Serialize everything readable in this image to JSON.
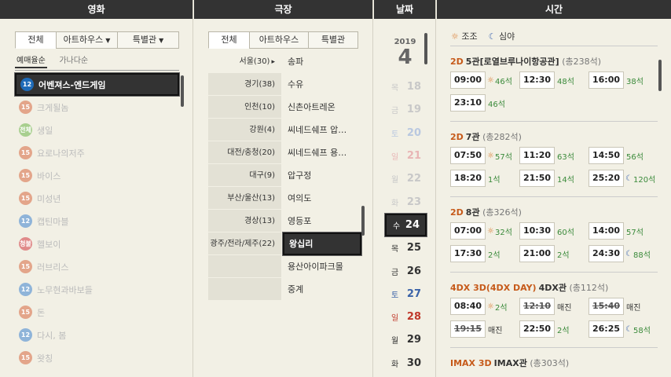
{
  "headers": {
    "movie": "영화",
    "theater": "극장",
    "date": "날짜",
    "time": "시간"
  },
  "movie": {
    "tabs": [
      "전체",
      "아트하우스",
      "특별관"
    ],
    "sort": [
      "예매율순",
      "가나다순"
    ],
    "items": [
      {
        "title": "어벤져스-엔드게임",
        "rating": "12",
        "color": "#1e6bb8",
        "selected": true
      },
      {
        "title": "크게될놈",
        "rating": "15",
        "color": "#e3a58a"
      },
      {
        "title": "생일",
        "rating": "전체",
        "color": "#a8cf8f"
      },
      {
        "title": "요로나의저주",
        "rating": "15",
        "color": "#e3a58a"
      },
      {
        "title": "바이스",
        "rating": "15",
        "color": "#e3a58a"
      },
      {
        "title": "미성년",
        "rating": "15",
        "color": "#e3a58a"
      },
      {
        "title": "캡틴마블",
        "rating": "12",
        "color": "#8fb4d9"
      },
      {
        "title": "헬보이",
        "rating": "청불",
        "color": "#e08a8a"
      },
      {
        "title": "러브리스",
        "rating": "15",
        "color": "#e3a58a"
      },
      {
        "title": "노무현과바보들",
        "rating": "12",
        "color": "#8fb4d9"
      },
      {
        "title": "돈",
        "rating": "15",
        "color": "#e3a58a"
      },
      {
        "title": "다시, 봄",
        "rating": "12",
        "color": "#8fb4d9"
      },
      {
        "title": "왓칭",
        "rating": "15",
        "color": "#e3a58a"
      }
    ]
  },
  "theater": {
    "tabs": [
      "전체",
      "아트하우스",
      "특별관"
    ],
    "regions": [
      "서울(30)",
      "경기(38)",
      "인천(10)",
      "강원(4)",
      "대전/충청(20)",
      "대구(9)",
      "부산/울산(13)",
      "경상(13)",
      "광주/전라/제주(22)",
      "",
      ""
    ],
    "active_region_arrow": "▸",
    "items": [
      {
        "name": "송파"
      },
      {
        "name": "수유"
      },
      {
        "name": "신촌아트레온"
      },
      {
        "name": "씨네드쉐프 압…"
      },
      {
        "name": "씨네드쉐프 용…"
      },
      {
        "name": "압구정"
      },
      {
        "name": "여의도"
      },
      {
        "name": "영등포"
      },
      {
        "name": "왕십리",
        "selected": true
      },
      {
        "name": "용산아이파크몰"
      },
      {
        "name": "중계"
      }
    ]
  },
  "date": {
    "year": "2019",
    "month": "4",
    "days": [
      {
        "wd": "목",
        "d": "18",
        "color": "#c8c8c8"
      },
      {
        "wd": "금",
        "d": "19",
        "color": "#c8c8c8"
      },
      {
        "wd": "토",
        "d": "20",
        "color": "#b9c8e0"
      },
      {
        "wd": "일",
        "d": "21",
        "color": "#e8b5b5"
      },
      {
        "wd": "월",
        "d": "22",
        "color": "#c8c8c8"
      },
      {
        "wd": "화",
        "d": "23",
        "color": "#c8c8c8"
      },
      {
        "wd": "수",
        "d": "24",
        "color": "#ffffff",
        "selected": true
      },
      {
        "wd": "목",
        "d": "25",
        "color": "#333333"
      },
      {
        "wd": "금",
        "d": "26",
        "color": "#333333"
      },
      {
        "wd": "토",
        "d": "27",
        "color": "#3b63a8"
      },
      {
        "wd": "일",
        "d": "28",
        "color": "#c0392b"
      },
      {
        "wd": "월",
        "d": "29",
        "color": "#333333"
      },
      {
        "wd": "화",
        "d": "30",
        "color": "#333333"
      }
    ]
  },
  "time": {
    "legend": {
      "morning": "조조",
      "night": "심야"
    },
    "sections": [
      {
        "format": "2D",
        "hall": "5관[로열브루나이항공관]",
        "seats": "(총238석)",
        "slots": [
          {
            "time": "09:00",
            "icon": "sun",
            "seats": "46석"
          },
          {
            "time": "12:30",
            "seats": "48석"
          },
          {
            "time": "16:00",
            "seats": "38석"
          },
          {
            "time": "23:10",
            "seats": "46석"
          }
        ]
      },
      {
        "format": "2D",
        "hall": "7관",
        "seats": "(총282석)",
        "slots": [
          {
            "time": "07:50",
            "icon": "sun",
            "seats": "57석"
          },
          {
            "time": "11:20",
            "seats": "63석"
          },
          {
            "time": "14:50",
            "seats": "56석"
          },
          {
            "time": "18:20",
            "seats": "1석"
          },
          {
            "time": "21:50",
            "seats": "14석"
          },
          {
            "time": "25:20",
            "icon": "moon",
            "seats": "120석"
          }
        ]
      },
      {
        "format": "2D",
        "hall": "8관",
        "seats": "(총326석)",
        "slots": [
          {
            "time": "07:00",
            "icon": "sun",
            "seats": "32석"
          },
          {
            "time": "10:30",
            "seats": "60석"
          },
          {
            "time": "14:00",
            "seats": "57석"
          },
          {
            "time": "17:30",
            "seats": "2석"
          },
          {
            "time": "21:00",
            "seats": "2석"
          },
          {
            "time": "24:30",
            "icon": "moon",
            "seats": "88석"
          }
        ]
      },
      {
        "format": "4DX 3D(4DX DAY)",
        "hall": "4DX관",
        "seats": "(총112석)",
        "slots": [
          {
            "time": "08:40",
            "icon": "sun",
            "seats": "2석"
          },
          {
            "time": "12:10",
            "seats": "매진",
            "closed": true
          },
          {
            "time": "15:40",
            "seats": "매진",
            "closed": true
          },
          {
            "time": "19:15",
            "seats": "매진",
            "closed": true
          },
          {
            "time": "22:50",
            "seats": "2석"
          },
          {
            "time": "26:25",
            "icon": "moon",
            "seats": "58석"
          }
        ]
      },
      {
        "format": "IMAX 3D",
        "hall": "IMAX관",
        "seats": "(총303석)",
        "slots": []
      }
    ]
  }
}
